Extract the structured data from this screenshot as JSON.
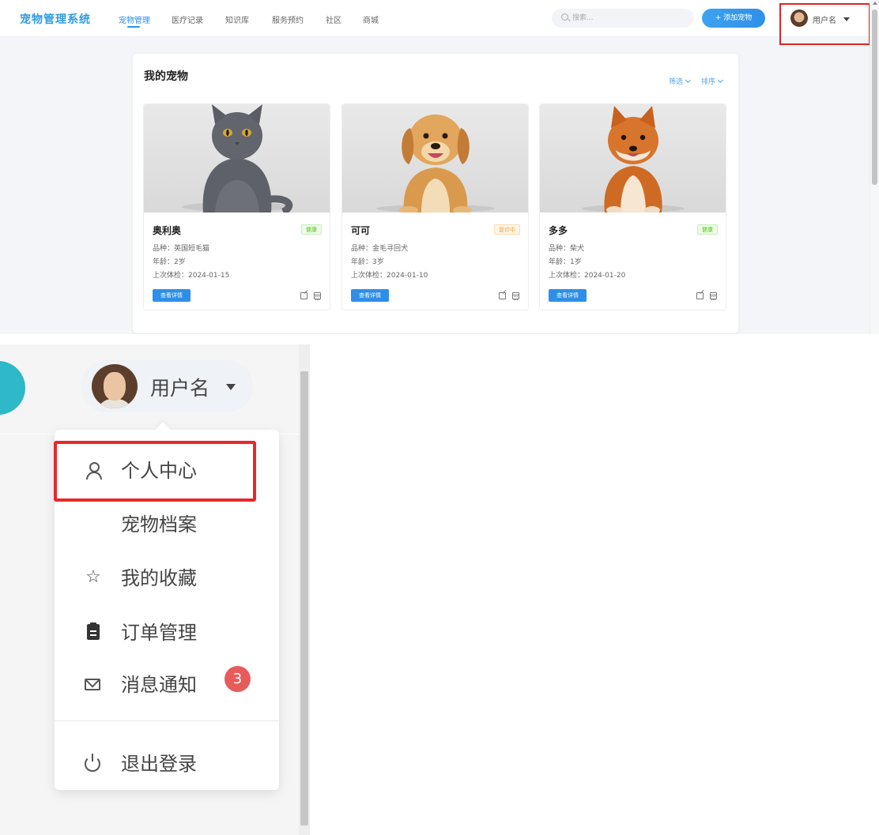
{
  "app": {
    "brand": "宠物管理系统",
    "nav": [
      {
        "label": "宠物管理",
        "active": true
      },
      {
        "label": "医疗记录",
        "active": false
      },
      {
        "label": "知识库",
        "active": false
      },
      {
        "label": "服务预约",
        "active": false
      },
      {
        "label": "社区",
        "active": false
      },
      {
        "label": "商城",
        "active": false
      }
    ],
    "search_placeholder": "搜索...",
    "add_pet_label": "+ 添加宠物",
    "username": "用户名"
  },
  "pets_panel": {
    "title": "我的宠物",
    "filter_label": "筛选",
    "sort_label": "排序",
    "pets": [
      {
        "name": "奥利奥",
        "status": "健康",
        "status_type": "healthy",
        "breed": "品种：英国短毛猫",
        "age": "年龄：2岁",
        "last_check": "上次体检：2024-01-15",
        "detail_label": "查看详情",
        "photo_icon": "cat-photo"
      },
      {
        "name": "可可",
        "status": "复诊中",
        "status_type": "recover",
        "breed": "品种：金毛寻回犬",
        "age": "年龄：3岁",
        "last_check": "上次体检：2024-01-10",
        "detail_label": "查看详情",
        "photo_icon": "golden-retriever-photo"
      },
      {
        "name": "多多",
        "status": "健康",
        "status_type": "healthy",
        "breed": "品种：柴犬",
        "age": "年龄：1岁",
        "last_check": "上次体检：2024-01-20",
        "detail_label": "查看详情",
        "photo_icon": "shiba-photo"
      }
    ]
  },
  "zoom": {
    "username": "用户名",
    "menu": [
      {
        "label": "个人中心",
        "icon": "user-icon"
      },
      {
        "label": "宠物档案",
        "icon": ""
      },
      {
        "label": "我的收藏",
        "icon": "star-icon"
      },
      {
        "label": "订单管理",
        "icon": "clipboard-icon"
      },
      {
        "label": "消息通知",
        "icon": "mail-icon",
        "badge": "3"
      },
      {
        "label": "退出登录",
        "icon": "power-icon"
      }
    ]
  },
  "colors": {
    "brand": "#2f9be0",
    "accent": "#2f8fe8",
    "highlight": "#e02424",
    "healthy": "#52c41a",
    "recover": "#f0a43a",
    "badge": "#e85b5b"
  }
}
